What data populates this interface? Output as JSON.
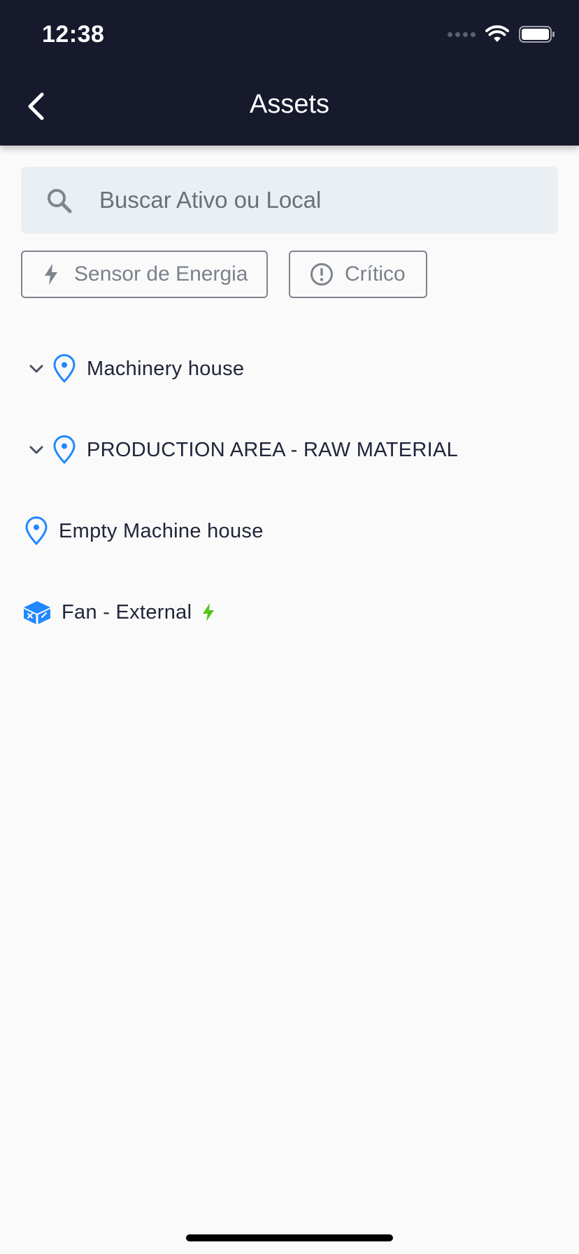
{
  "status_bar": {
    "time": "12:38"
  },
  "header": {
    "title": "Assets"
  },
  "search": {
    "placeholder": "Buscar Ativo ou Local",
    "value": ""
  },
  "filters": [
    {
      "label": "Sensor de Energia",
      "icon": "bolt-icon"
    },
    {
      "label": "Crítico",
      "icon": "alert-circle-icon"
    }
  ],
  "tree": [
    {
      "label": "Machinery house",
      "type": "location",
      "expandable": true
    },
    {
      "label": "PRODUCTION AREA - RAW MATERIAL",
      "type": "location",
      "expandable": true
    },
    {
      "label": "Empty Machine house",
      "type": "location",
      "expandable": false
    },
    {
      "label": "Fan - External",
      "type": "asset",
      "expandable": false,
      "sensor": "energy"
    }
  ],
  "colors": {
    "header_bg": "#17192d",
    "location_icon": "#2188ff",
    "asset_icon": "#2188ff",
    "energy_bolt": "#52c41a"
  }
}
